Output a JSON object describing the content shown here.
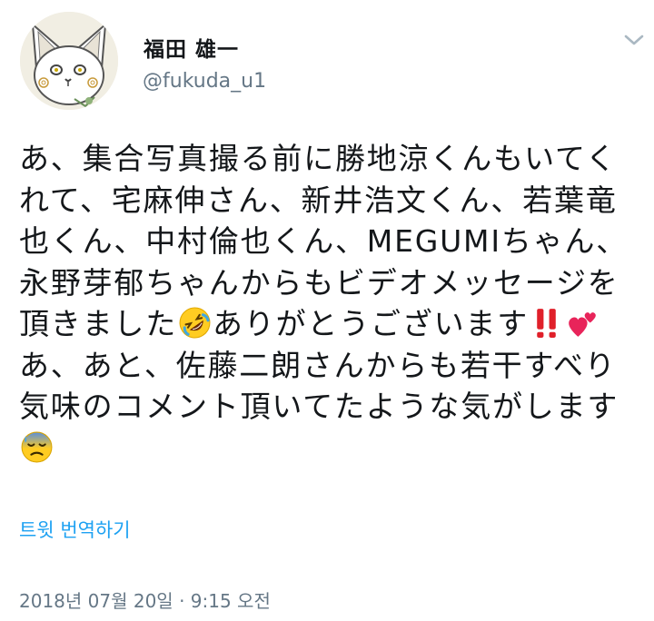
{
  "tweet": {
    "author": {
      "display_name": "福田 雄一",
      "handle": "@fukuda_u1",
      "avatar": "illustrated-cat-avatar"
    },
    "menu_icon": "chevron-down-icon",
    "text_lines": [
      [
        {
          "text": "あ、集合写真撮る前に勝地涼くんもいてく"
        }
      ],
      [
        {
          "text": "れて、宅麻伸さん、新井浩文くん、若葉竜"
        }
      ],
      [
        {
          "text": "也くん、中村倫也くん、MEGUMIちゃん、"
        }
      ],
      [
        {
          "text": "永野芽郁ちゃんからもビデオメッセージを"
        }
      ],
      [
        {
          "text": "頂きました"
        },
        {
          "emoji": "rolling-on-floor-laughing"
        },
        {
          "text": "ありがとうございます"
        },
        {
          "emoji": "double-exclamation"
        },
        {
          "emoji": "two-hearts"
        }
      ],
      [
        {
          "text": "あ、あと、佐藤二朗さんからも若干すべり"
        }
      ],
      [
        {
          "text": "気味のコメント頂いてたような気がします"
        }
      ],
      [
        {
          "emoji": "anxious-face-with-sweat"
        }
      ]
    ],
    "translate_label": "트윗 번역하기",
    "timestamp": "2018년 07월 20일 · 9:15 오전"
  },
  "colors": {
    "text": "#14171a",
    "secondary": "#657786",
    "link": "#1da1f2",
    "background": "#ffffff"
  }
}
